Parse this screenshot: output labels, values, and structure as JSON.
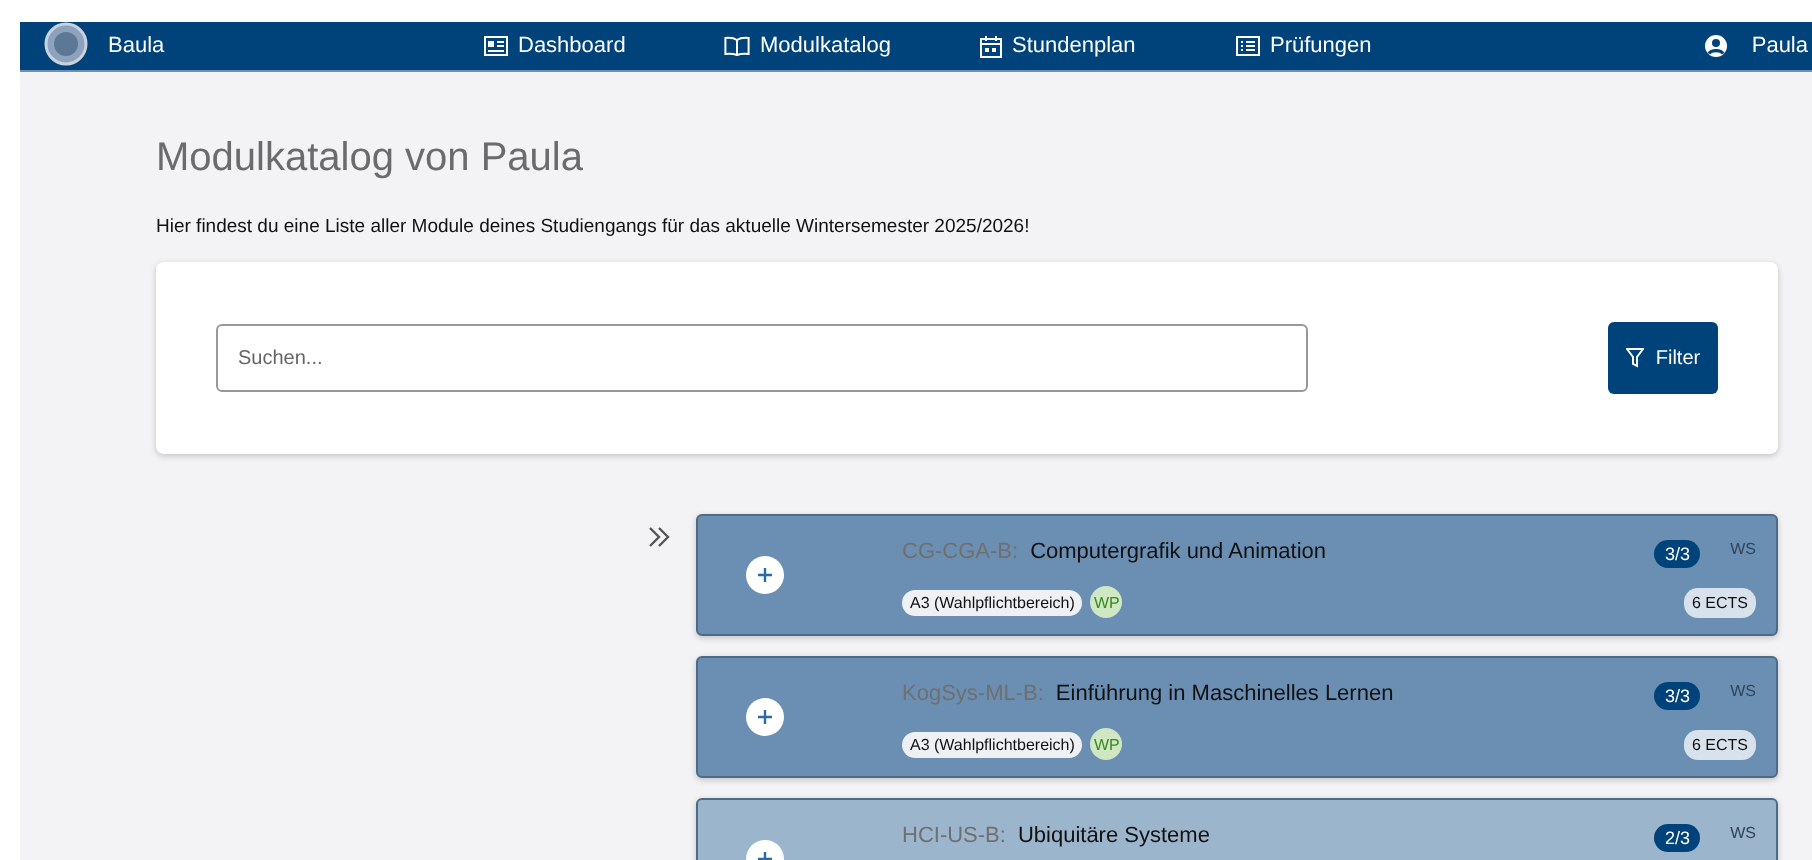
{
  "navbar": {
    "brand": "Baula",
    "links": [
      {
        "label": "Dashboard",
        "kind": "card"
      },
      {
        "label": "Modulkatalog",
        "kind": "book"
      },
      {
        "label": "Stundenplan",
        "kind": "calendar"
      },
      {
        "label": "Prüfungen",
        "kind": "list"
      }
    ],
    "user": "Paula"
  },
  "page": {
    "title": "Modulkatalog von Paula",
    "subtitle": "Hier findest du eine Liste aller Module deines Studiengangs für das aktuelle Wintersemester 2025/2026!"
  },
  "search": {
    "placeholder": "Suchen...",
    "filter_button": "Filter"
  },
  "modules": [
    {
      "code": "CG-CGA-B:",
      "name": "Computergrafik und Animation",
      "count": "3/3",
      "semester": "WS",
      "color": "#6a8fb3",
      "area": "A3 (Wahlpflichtbereich)",
      "type": "WP",
      "ects": "6 ECTS"
    },
    {
      "code": "KogSys-ML-B:",
      "name": "Einführung in Maschinelles Lernen",
      "count": "3/3",
      "semester": "WS",
      "color": "#6a8fb3",
      "area": "A3 (Wahlpflichtbereich)",
      "type": "WP",
      "ects": "6 ECTS"
    },
    {
      "code": "HCI-US-B:",
      "name": "Ubiquitäre Systeme",
      "count": "2/3",
      "semester": "WS",
      "color": "#9bb6cc"
    }
  ]
}
